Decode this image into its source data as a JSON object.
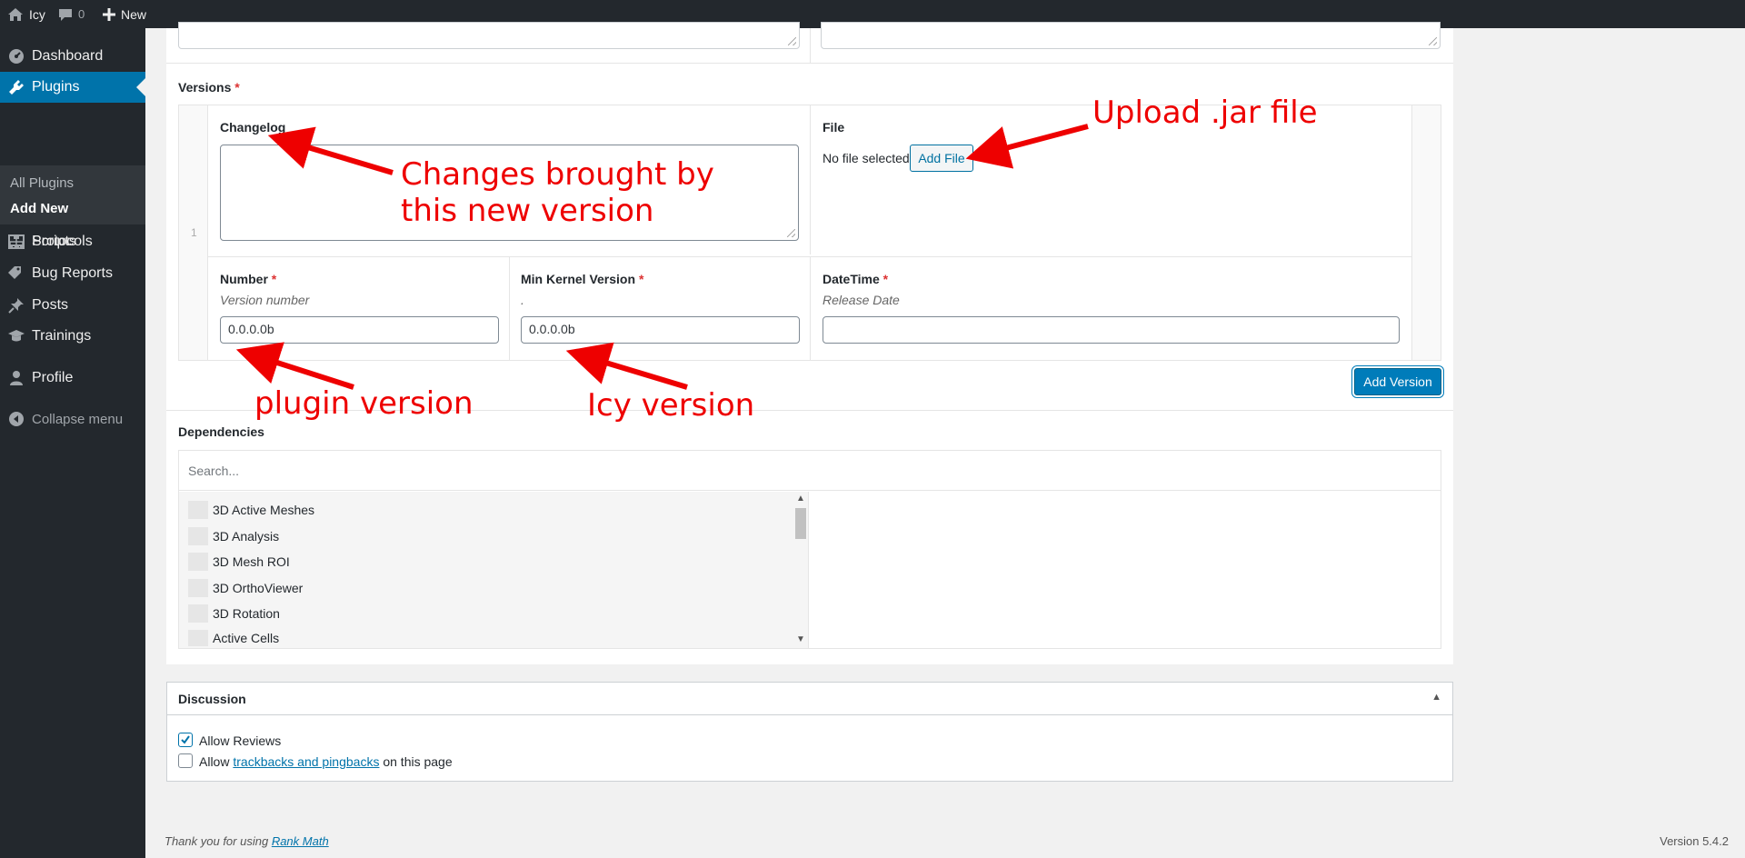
{
  "admin_bar": {
    "site_name": "Icy",
    "comments_count": "0",
    "new_label": "New"
  },
  "sidebar": {
    "items": [
      {
        "label": "Dashboard",
        "icon": "dashboard-icon"
      },
      {
        "label": "Plugins",
        "icon": "plugins-icon"
      },
      {
        "label": "Protocols",
        "icon": "protocols-icon"
      },
      {
        "label": "Scripts",
        "icon": "scripts-icon"
      },
      {
        "label": "Bug Reports",
        "icon": "tag-icon"
      },
      {
        "label": "Posts",
        "icon": "pin-icon"
      },
      {
        "label": "Trainings",
        "icon": "graduation-cap-icon"
      },
      {
        "label": "Profile",
        "icon": "user-icon"
      },
      {
        "label": "Collapse menu",
        "icon": "collapse-icon"
      }
    ],
    "submenu": [
      {
        "label": "All Plugins"
      },
      {
        "label": "Add New"
      }
    ]
  },
  "versions": {
    "title": "Versions",
    "required": "*",
    "row_index": "1",
    "changelog_label": "Changelog",
    "file_label": "File",
    "no_file_text": "No file selected",
    "add_file_label": "Add File",
    "number_label": "Number",
    "number_desc": "Version number",
    "number_value": "0.0.0.0b",
    "kernel_label": "Min Kernel Version",
    "kernel_desc": ".",
    "kernel_value": "0.0.0.0b",
    "datetime_label": "DateTime",
    "datetime_desc": "Release Date",
    "datetime_value": "",
    "add_version_label": "Add Version"
  },
  "annotations": {
    "changes_line1": "Changes brought by",
    "changes_line2": "this new version",
    "upload": "Upload .jar file",
    "plugin_version": "plugin version",
    "icy_version": "Icy version",
    "color": "#ee0000"
  },
  "dependencies": {
    "title": "Dependencies",
    "search_placeholder": "Search...",
    "items": [
      "3D Active Meshes",
      "3D Analysis",
      "3D Mesh ROI",
      "3D OrthoViewer",
      "3D Rotation",
      "Active Cells"
    ]
  },
  "discussion": {
    "title": "Discussion",
    "allow_reviews": "Allow Reviews",
    "allow_reviews_checked": true,
    "allow_prefix": "Allow",
    "trackbacks_link": "trackbacks and pingbacks",
    "allow_suffix": "on this page",
    "allow_trackbacks_checked": false
  },
  "footer": {
    "thanks_prefix": "Thank you for using",
    "rank_math": "Rank Math",
    "version": "Version 5.4.2"
  },
  "colors": {
    "accent": "#0073aa",
    "sidebar_bg": "#23282d",
    "annotation": "#ee0000"
  }
}
